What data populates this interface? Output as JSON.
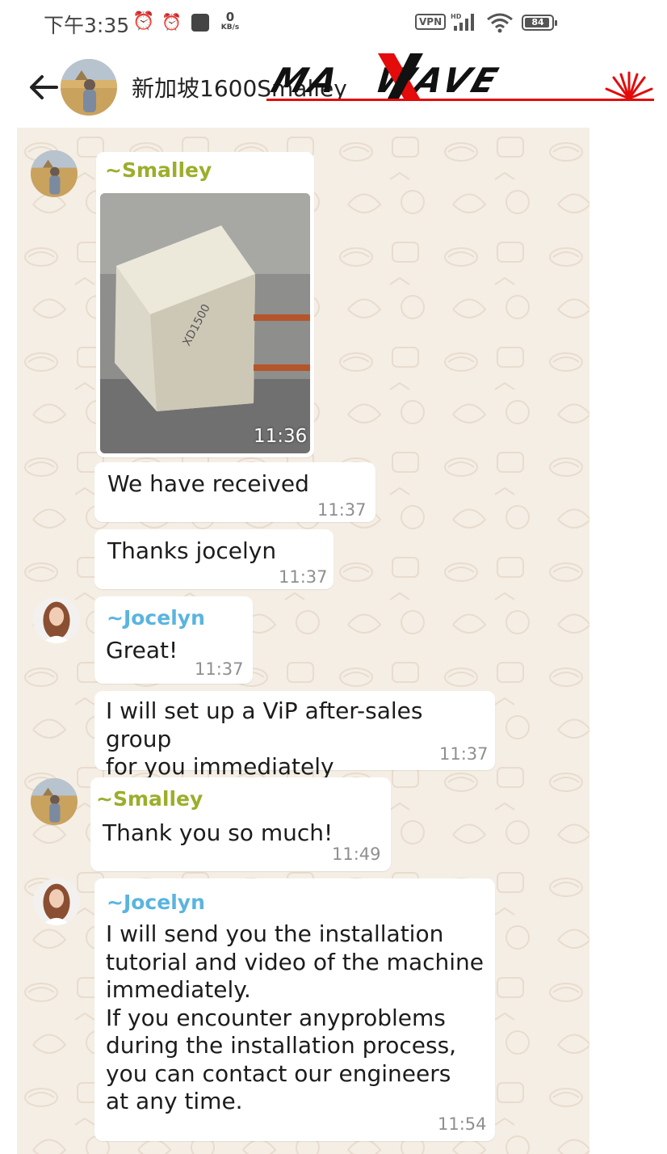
{
  "status_bar": {
    "time": "下午3:35",
    "data_rate_value": "0",
    "data_rate_unit": "KB/s",
    "vpn": "VPN",
    "battery": "84"
  },
  "header": {
    "group_title": "新加坡1600Smalley",
    "watermark_logo": "MAXWAVE"
  },
  "messages": [
    {
      "sender": "~Smalley",
      "type": "image",
      "time": "11:36"
    },
    {
      "text": "We have received",
      "time": "11:37"
    },
    {
      "text": "Thanks jocelyn",
      "time": "11:37"
    },
    {
      "sender": "~Jocelyn",
      "text": "Great!",
      "time": "11:37"
    },
    {
      "text": "I will set up a ViP after-sales group\nfor you immediately",
      "time": "11:37"
    },
    {
      "sender": "~Smalley",
      "text": "Thank you so much!",
      "time": "11:49"
    },
    {
      "sender": "~Jocelyn",
      "text": "I will send you the installation\ntutorial and video of the machine\nimmediately.\nIf you encounter anyproblems\nduring the installation process,\nyou can contact our engineers\nat any time.",
      "time": "11:54"
    }
  ],
  "colors": {
    "smalley_name": "#9cae2b",
    "jocelyn_name": "#5ab4e0",
    "wallpaper": "#f5eee5",
    "logo_accent": "#e30b0b"
  },
  "icons": [
    "alarm-clock-icon",
    "alarm-icon",
    "app-square-icon",
    "signal-icon",
    "wifi-icon",
    "battery-icon",
    "back-arrow-icon"
  ]
}
